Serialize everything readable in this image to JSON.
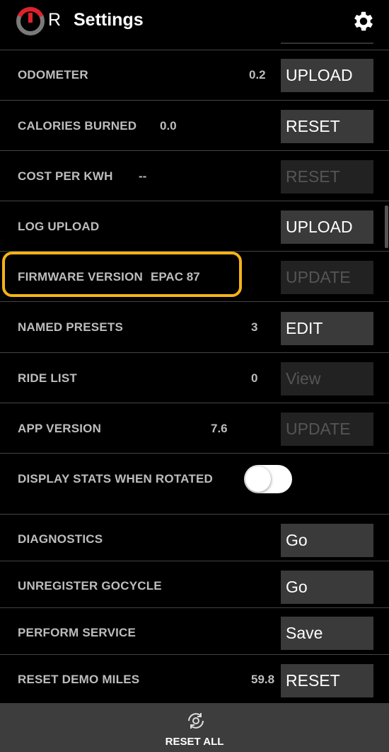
{
  "header": {
    "logo_letter": "R",
    "title": "Settings",
    "icons": {
      "logo": "power-ring-logo",
      "settings": "gear-icon"
    }
  },
  "rows": [
    {
      "label": "ODOMETER",
      "value": "0.2",
      "button": "UPLOAD",
      "button_enabled": true
    },
    {
      "label": "CALORIES BURNED",
      "value": "0.0",
      "button": "RESET",
      "button_enabled": true
    },
    {
      "label": "COST PER KWH",
      "value": "--",
      "button": "RESET",
      "button_enabled": false
    },
    {
      "label": "LOG UPLOAD",
      "value": "",
      "button": "UPLOAD",
      "button_enabled": true
    },
    {
      "label": "FIRMWARE VERSION",
      "value": "EPAC 87",
      "button": "UPDATE",
      "button_enabled": false,
      "highlighted": true
    },
    {
      "label": "NAMED PRESETS",
      "value": "3",
      "button": "EDIT",
      "button_enabled": true
    },
    {
      "label": "RIDE LIST",
      "value": "0",
      "button": "View",
      "button_enabled": false
    },
    {
      "label": "APP VERSION",
      "value": "7.6",
      "button": "UPDATE",
      "button_enabled": false
    },
    {
      "label": "DISPLAY STATS WHEN ROTATED",
      "toggle_state": "off"
    },
    {
      "label": "DIAGNOSTICS",
      "value": "",
      "button": "Go",
      "button_enabled": true
    },
    {
      "label": "UNREGISTER GOCYCLE",
      "value": "",
      "button": "Go",
      "button_enabled": true
    },
    {
      "label": "PERFORM SERVICE",
      "value": "",
      "button": "Save",
      "button_enabled": true
    },
    {
      "label": "RESET DEMO MILES",
      "value": "59.8",
      "button": "RESET",
      "button_enabled": true
    }
  ],
  "bottom_bar": {
    "label": "RESET ALL",
    "icon": "reset-all-icon"
  },
  "colors": {
    "highlight": "#f5b318",
    "background": "#000000",
    "button": "#3a3a3a",
    "logo_red": "#e0212b"
  }
}
